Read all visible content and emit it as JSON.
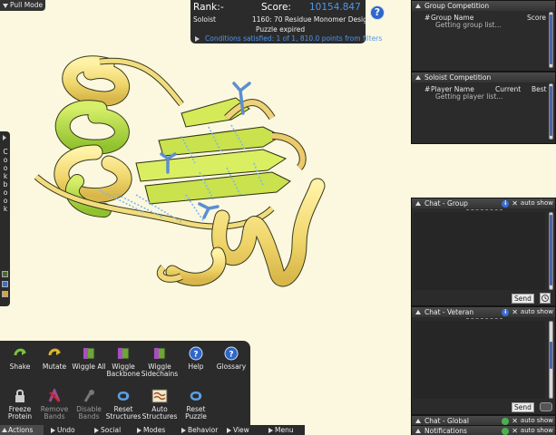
{
  "top_left": {
    "label": "Pull Mode"
  },
  "score_panel": {
    "rank_label": "Rank:",
    "rank_value": "-",
    "score_label": "Score:",
    "score_value": "10154.847",
    "mode": "Soloist",
    "puzzle_name": "1160: 70 Residue Monomer Design",
    "status": "Puzzle expired",
    "conditions": "Conditions satisfied: 1 of 1, 810.0 points from filters",
    "help_icon": "question-icon"
  },
  "cookbook": {
    "label": "Cookbook",
    "letters": [
      "C",
      "o",
      "o",
      "k",
      "b",
      "o",
      "o",
      "k"
    ]
  },
  "group_competition": {
    "title": "Group Competition",
    "col_rank": "#",
    "col_name": "Group Name",
    "col_score": "Score",
    "loading": "Getting group list..."
  },
  "soloist_competition": {
    "title": "Soloist Competition",
    "col_rank": "#",
    "col_name": "Player Name",
    "col_current": "Current",
    "col_best": "Best",
    "loading": "Getting player list..."
  },
  "chat_group": {
    "title": "Chat - Group",
    "auto_show": "auto show",
    "send": "Send"
  },
  "chat_veteran": {
    "title": "Chat - Veteran",
    "auto_show": "auto show",
    "send": "Send"
  },
  "chat_global": {
    "title": "Chat - Global",
    "auto_show": "auto show"
  },
  "notifications": {
    "title": "Notifications",
    "auto_show": "auto show"
  },
  "actions": {
    "row1": [
      {
        "label": "Shake",
        "icon": "shake-icon"
      },
      {
        "label": "Mutate",
        "icon": "mutate-icon"
      },
      {
        "label": "Wiggle All",
        "icon": "wiggle-all-icon"
      },
      {
        "label": "Wiggle Backbone",
        "icon": "wiggle-backbone-icon"
      },
      {
        "label": "Wiggle Sidechains",
        "icon": "wiggle-sidechains-icon"
      },
      {
        "label": "Help",
        "icon": "help-icon"
      },
      {
        "label": "Glossary",
        "icon": "glossary-icon"
      }
    ],
    "row2": [
      {
        "label": "Freeze Protein",
        "icon": "lock-icon"
      },
      {
        "label": "Remove Bands",
        "icon": "remove-bands-icon",
        "disabled": true
      },
      {
        "label": "Disable Bands",
        "icon": "disable-bands-icon",
        "disabled": true
      },
      {
        "label": "Reset Structures",
        "icon": "reset-structures-icon"
      },
      {
        "label": "Auto Structures",
        "icon": "auto-structures-icon"
      },
      {
        "label": "Reset Puzzle",
        "icon": "reset-puzzle-icon"
      }
    ]
  },
  "bottom_tabs": [
    "Actions",
    "Undo",
    "Social",
    "Modes",
    "Behavior",
    "View",
    "Menu"
  ],
  "colors": {
    "background": "#fbf8df",
    "panel": "#2b2b2b",
    "score_blue": "#3f8fe8",
    "helix_yellow": "#f4e27a",
    "sheet_green": "#a8d63a",
    "band_blue": "#7ab6ec"
  }
}
